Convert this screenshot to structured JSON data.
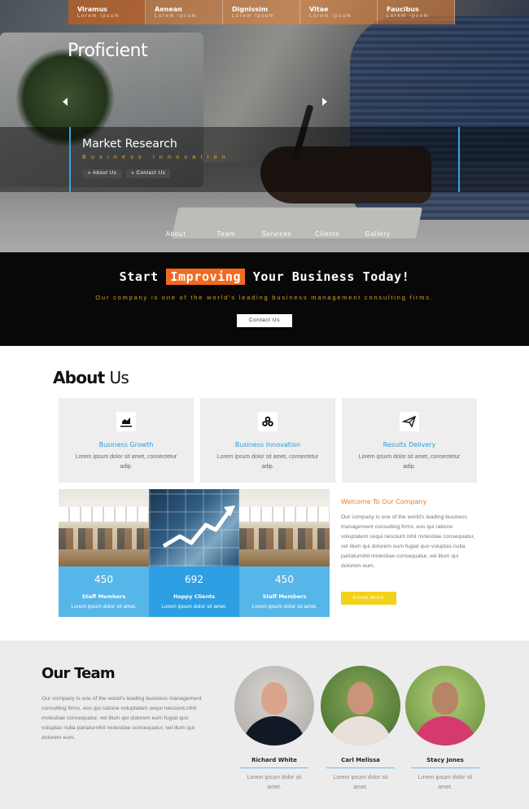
{
  "top_nav": [
    {
      "title": "Viramus",
      "sub": "Lorem ipsum"
    },
    {
      "title": "Aenean",
      "sub": "Lorem ipsum"
    },
    {
      "title": "Dignissim",
      "sub": "Lorem ipsum"
    },
    {
      "title": "Vitae",
      "sub": "Lorem ipsum"
    },
    {
      "title": "Faucibus",
      "sub": "Lorem ipsum"
    }
  ],
  "logo": "Proficient",
  "banner": {
    "title": "Market Research",
    "tagline": "Business innovation",
    "btn_about": "» About Us",
    "btn_contact": "» Contact Us"
  },
  "sub_nav": [
    "About",
    "Team",
    "Services",
    "Clients",
    "Gallery"
  ],
  "cta": {
    "title_before": "Start",
    "title_highlight": "Improving",
    "title_after": "Your Business Today!",
    "text": "Our company is one of the world's leading business management consulting firms.",
    "button": "Contact Us"
  },
  "about": {
    "title_bold": "About",
    "title_rest": "Us",
    "cards": [
      {
        "icon": "bar-chart-icon",
        "title": "Business Growth",
        "text": "Lorem ipsum dolor sit amet, consectetur adip."
      },
      {
        "icon": "coins-icon",
        "title": "Business Innovation",
        "text": "Lorem ipsum dolor sit amet, consectetur adip."
      },
      {
        "icon": "paper-plane-icon",
        "title": "Results Delivery",
        "text": "Lorem ipsum dolor sit amet, consectetur adip."
      }
    ],
    "stats": [
      {
        "number": "450",
        "label": "Staff Members",
        "text": "Lorem ipsum dolor sit amet."
      },
      {
        "number": "692",
        "label": "Happy Clients",
        "text": "Lorem ipsum dolor sit amet."
      },
      {
        "number": "450",
        "label": "Staff Members",
        "text": "Lorem ipsum dolor sit amet."
      }
    ],
    "welcome_title": "Welcome To Our Company",
    "welcome_text": "Our company is one of the world's leading business management consulting firms. eos qui ratione voluptatem sequi nesciunt.nihil molestiae consequatur, vel illum qui dolorem eum fugiat quo voluptas nulla pariaturnihil molestiae consequatur, vel illum qui dolorem eum.",
    "know_more": "Know More"
  },
  "team": {
    "title_bold": "Our",
    "title_rest": "Team",
    "text": "Our company is one of the world's leading business management consulting firms. eos qui ratione voluptatem sequi nesciunt.nihil molestiae consequatur, vel illum qui dolorem eum fugiat quo voluptas nulla pariaturnihil molestiae consequatur, vel illum qui dolorem eum.",
    "members": [
      {
        "name": "Richard White",
        "text": "Lorem ipsum dolor sit amet."
      },
      {
        "name": "Carl Melissa",
        "text": "Lorem ipsum dolor sit amet."
      },
      {
        "name": "Stacy Jones",
        "text": "Lorem ipsum dolor sit amet."
      }
    ]
  },
  "colors": {
    "accent_orange": "#f26a21",
    "accent_blue": "#2d9fe2",
    "accent_yellow": "#f3d21a"
  }
}
